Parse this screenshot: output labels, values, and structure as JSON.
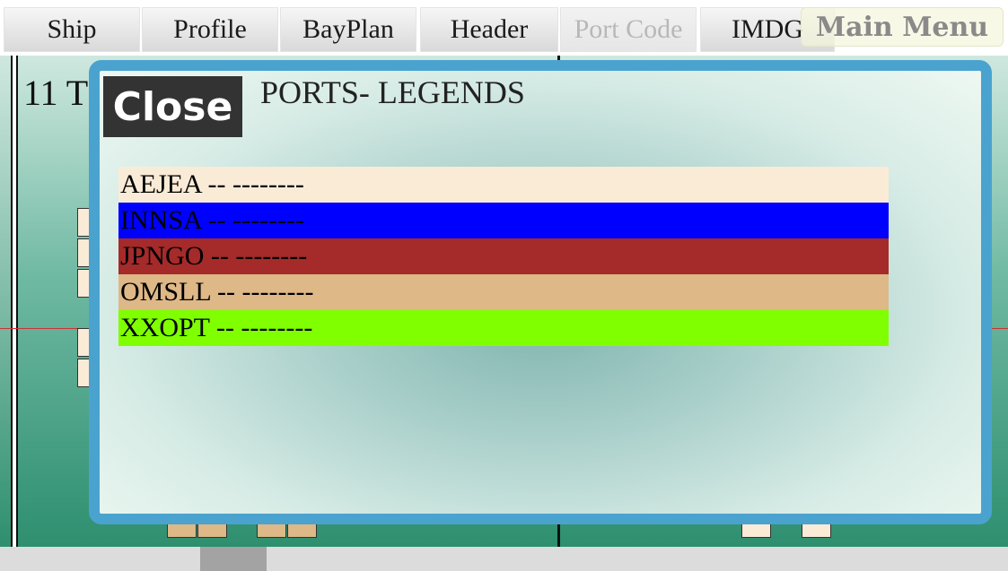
{
  "tabs": [
    {
      "label": "Ship",
      "disabled": false
    },
    {
      "label": "Profile",
      "disabled": false
    },
    {
      "label": "BayPlan",
      "disabled": false
    },
    {
      "label": "Header",
      "disabled": false
    },
    {
      "label": "Port Code",
      "disabled": true
    },
    {
      "label": "IMDG",
      "disabled": false
    }
  ],
  "main_menu_label": "Main Menu",
  "background": {
    "panel_title": "11 T"
  },
  "modal": {
    "close_label": "Close",
    "title": "PORTS- LEGENDS",
    "legends": [
      {
        "text": "AEJEA -- --------",
        "color": "#faebd7"
      },
      {
        "text": "INNSA -- --------",
        "color": "#0000ff"
      },
      {
        "text": "JPNGO -- --------",
        "color": "#a52a2a"
      },
      {
        "text": "OMSLL -- --------",
        "color": "#deb887"
      },
      {
        "text": "XXOPT -- --------",
        "color": "#7fff00"
      }
    ]
  },
  "colors": {
    "modal_border": "#4aa3cf",
    "close_button_bg": "#333333"
  }
}
